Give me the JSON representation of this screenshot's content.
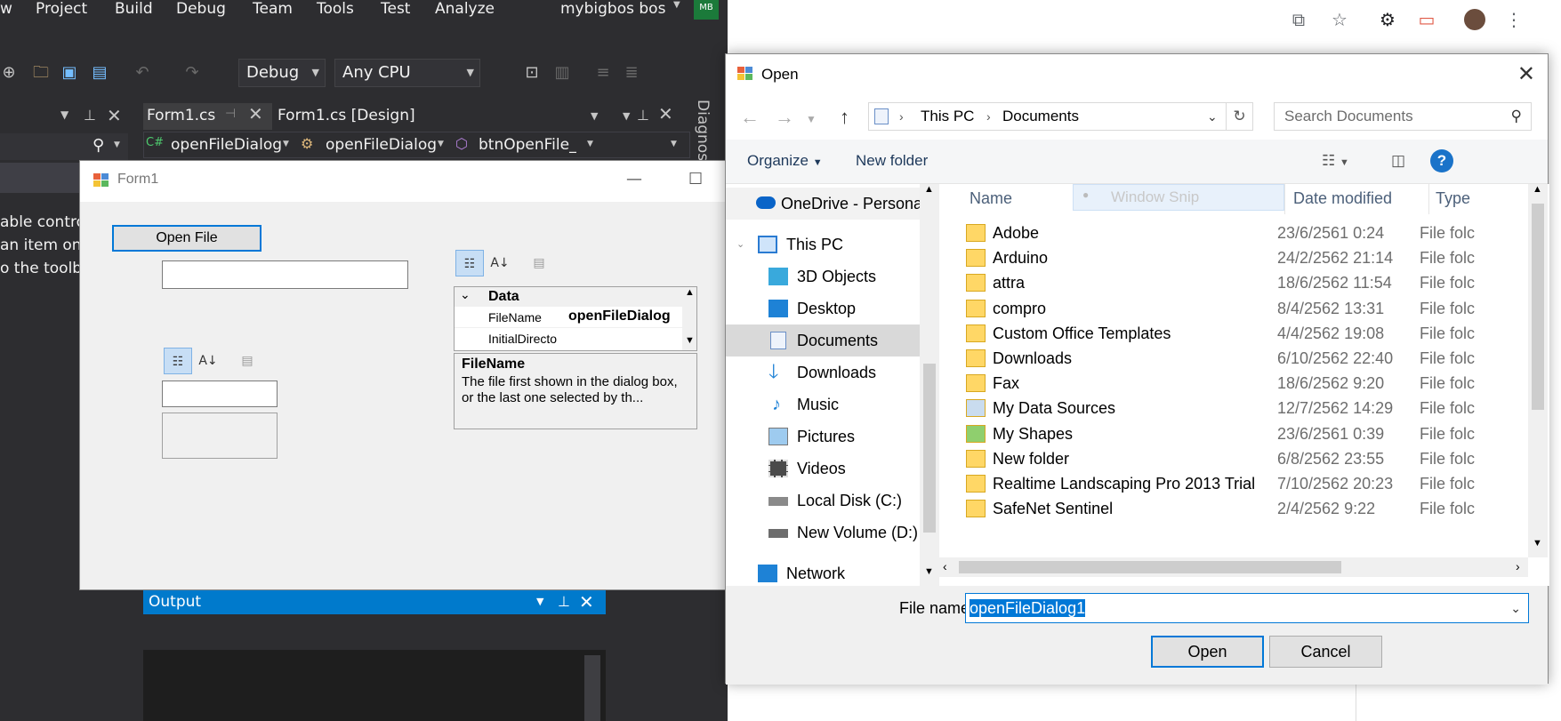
{
  "vs": {
    "menu": [
      "w",
      "Project",
      "Build",
      "Debug",
      "Team",
      "Tools",
      "Test",
      "Analyze"
    ],
    "account": "mybigbos bos",
    "avatar_initials": "MB",
    "config_combo": "Debug",
    "platform_combo": "Any CPU",
    "tabs": {
      "code": "Form1.cs",
      "design": "Form1.cs [Design]"
    },
    "nav_bar": [
      "openFileDialog",
      "openFileDialog",
      "btnOpenFile_Cl"
    ],
    "side_text": [
      "able contro",
      "an item ont",
      "o the toolb"
    ],
    "diagnostics": "Diagnos",
    "output_title": "Output"
  },
  "form1": {
    "title": "Form1",
    "open_button": "Open File",
    "propgrid": {
      "category": "Data",
      "rows": [
        {
          "name": "FileName",
          "value": "openFileDialog"
        },
        {
          "name": "InitialDirecto",
          "value": ""
        }
      ],
      "desc_title": "FileName",
      "desc_text": "The file first shown in the dialog box, or the last one selected by th..."
    }
  },
  "dialog": {
    "title": "Open",
    "breadcrumb": [
      "This PC",
      "Documents"
    ],
    "search_placeholder": "Search Documents",
    "organize": "Organize",
    "new_folder": "New folder",
    "ghost_tooltip": "Window Snip",
    "nav_items": [
      {
        "label": "OneDrive - Persona",
        "icon": "cloud-icon"
      },
      {
        "label": "This PC",
        "icon": "computer-icon"
      },
      {
        "label": "3D Objects",
        "icon": "cube-icon"
      },
      {
        "label": "Desktop",
        "icon": "desktop-icon"
      },
      {
        "label": "Documents",
        "icon": "document-icon"
      },
      {
        "label": "Downloads",
        "icon": "download-icon"
      },
      {
        "label": "Music",
        "icon": "music-icon"
      },
      {
        "label": "Pictures",
        "icon": "picture-icon"
      },
      {
        "label": "Videos",
        "icon": "video-icon"
      },
      {
        "label": "Local Disk (C:)",
        "icon": "drive-icon"
      },
      {
        "label": "New Volume (D:)",
        "icon": "drive-icon"
      },
      {
        "label": "Network",
        "icon": "network-icon"
      }
    ],
    "columns": {
      "name": "Name",
      "date": "Date modified",
      "type": "Type"
    },
    "files": [
      {
        "name": "Adobe",
        "date": "23/6/2561 0:24",
        "type": "File folc"
      },
      {
        "name": "Arduino",
        "date": "24/2/2562 21:14",
        "type": "File folc"
      },
      {
        "name": "attra",
        "date": "18/6/2562 11:54",
        "type": "File folc"
      },
      {
        "name": "compro",
        "date": "8/4/2562 13:31",
        "type": "File folc"
      },
      {
        "name": "Custom Office Templates",
        "date": "4/4/2562 19:08",
        "type": "File folc"
      },
      {
        "name": "Downloads",
        "date": "6/10/2562 22:40",
        "type": "File folc"
      },
      {
        "name": "Fax",
        "date": "18/6/2562 9:20",
        "type": "File folc"
      },
      {
        "name": "My Data Sources",
        "date": "12/7/2562 14:29",
        "type": "File folc"
      },
      {
        "name": "My Shapes",
        "date": "23/6/2561 0:39",
        "type": "File folc"
      },
      {
        "name": "New folder",
        "date": "6/8/2562 23:55",
        "type": "File folc"
      },
      {
        "name": "Realtime Landscaping Pro 2013 Trial",
        "date": "7/10/2562 20:23",
        "type": "File folc"
      },
      {
        "name": "SafeNet Sentinel",
        "date": "2/4/2562 9:22",
        "type": "File folc"
      }
    ],
    "file_name_label": "File name:",
    "file_name_value": "openFileDialog1",
    "open_button": "Open",
    "cancel_button": "Cancel"
  },
  "colors": {
    "accent": "#0078d7",
    "vs_bg": "#2d2d30",
    "vs_blue": "#007acc",
    "folder": "#ffd766"
  }
}
